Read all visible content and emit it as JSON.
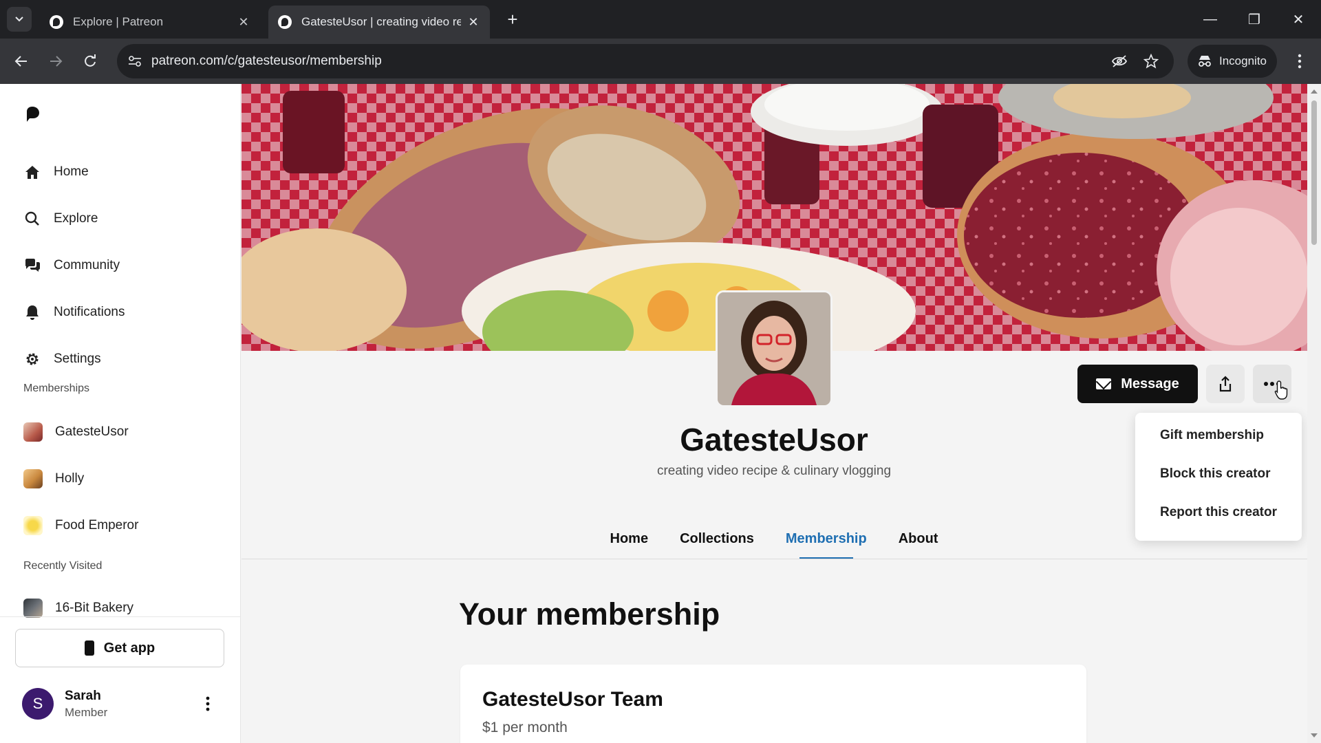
{
  "browser": {
    "tabs": [
      {
        "title": "Explore | Patreon",
        "close": "✕"
      },
      {
        "title": "GatesteUsor | creating video re",
        "close": "✕"
      }
    ],
    "new_tab": "+",
    "url": "patreon.com/c/gatesteusor/membership",
    "incognito_label": "Incognito",
    "window_controls": {
      "minimize": "—",
      "restore": "❐",
      "close": "✕"
    }
  },
  "sidebar": {
    "nav": [
      {
        "label": "Home",
        "icon": "home-icon"
      },
      {
        "label": "Explore",
        "icon": "search-icon"
      },
      {
        "label": "Community",
        "icon": "chat-icon"
      },
      {
        "label": "Notifications",
        "icon": "bell-icon"
      },
      {
        "label": "Settings",
        "icon": "gear-icon"
      }
    ],
    "memberships_label": "Memberships",
    "memberships": [
      {
        "label": "GatesteUsor",
        "color": "#b85a4a"
      },
      {
        "label": "Holly",
        "color": "#c9883e"
      },
      {
        "label": "Food Emperor",
        "color": "#f3e26a"
      }
    ],
    "recently_visited_label": "Recently Visited",
    "recent": [
      {
        "label": "16-Bit Bakery",
        "color": "#555a5f"
      }
    ],
    "get_app": "Get app",
    "user": {
      "initial": "S",
      "name": "Sarah",
      "role": "Member"
    }
  },
  "creator": {
    "name": "GatesteUsor",
    "tagline": "creating video recipe & culinary vlogging",
    "message_button": "Message",
    "tabs": [
      "Home",
      "Collections",
      "Membership",
      "About"
    ],
    "active_tab": "Membership"
  },
  "more_menu": {
    "items": [
      "Gift membership",
      "Block this creator",
      "Report this creator"
    ]
  },
  "membership": {
    "heading": "Your membership",
    "tier_name": "GatesteUsor Team",
    "tier_price": "$1 per month"
  },
  "colors": {
    "accent": "#1f6fb2",
    "user_avatar": "#3c1a6e"
  }
}
